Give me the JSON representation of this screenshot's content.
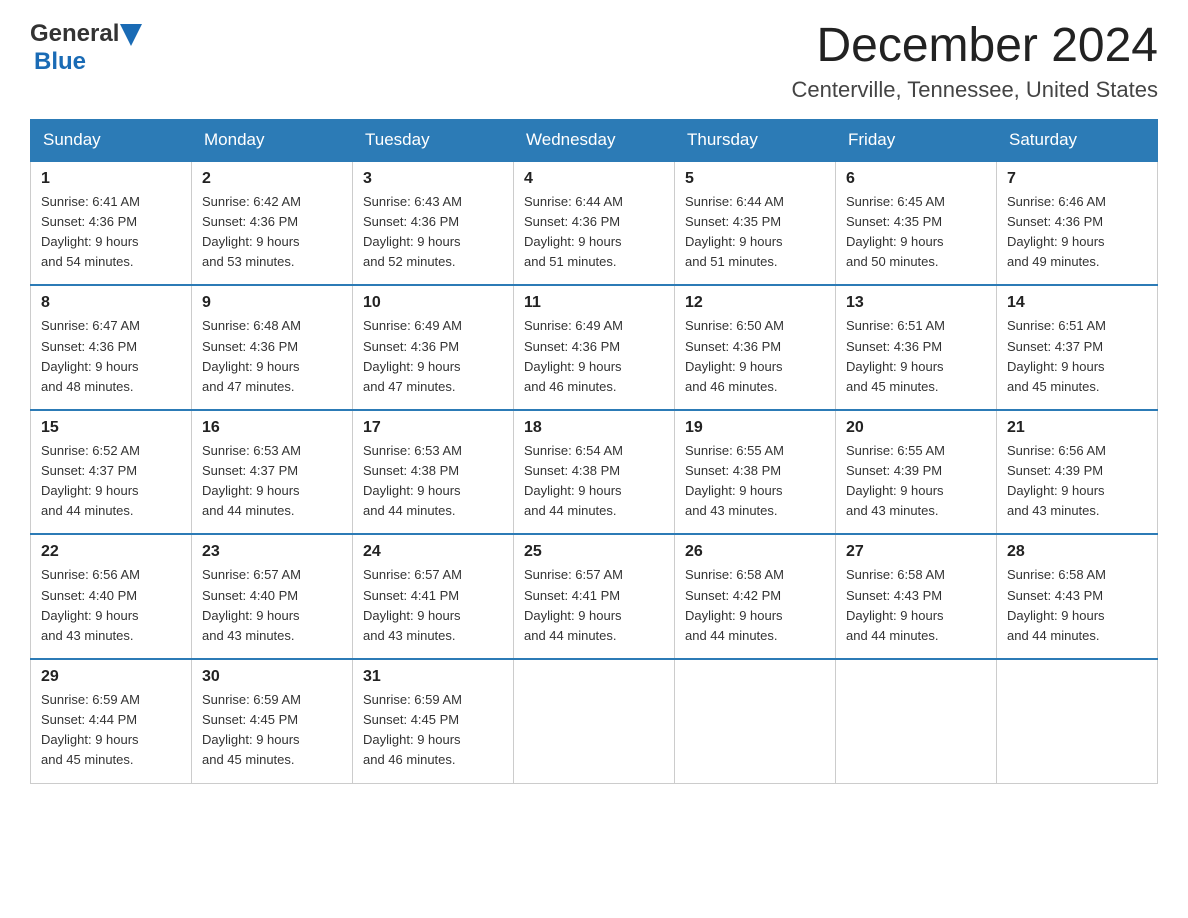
{
  "header": {
    "logo_general": "General",
    "logo_blue": "Blue",
    "month_title": "December 2024",
    "location": "Centerville, Tennessee, United States"
  },
  "days_of_week": [
    "Sunday",
    "Monday",
    "Tuesday",
    "Wednesday",
    "Thursday",
    "Friday",
    "Saturday"
  ],
  "weeks": [
    [
      {
        "day": "1",
        "sunrise": "6:41 AM",
        "sunset": "4:36 PM",
        "daylight": "9 hours and 54 minutes."
      },
      {
        "day": "2",
        "sunrise": "6:42 AM",
        "sunset": "4:36 PM",
        "daylight": "9 hours and 53 minutes."
      },
      {
        "day": "3",
        "sunrise": "6:43 AM",
        "sunset": "4:36 PM",
        "daylight": "9 hours and 52 minutes."
      },
      {
        "day": "4",
        "sunrise": "6:44 AM",
        "sunset": "4:36 PM",
        "daylight": "9 hours and 51 minutes."
      },
      {
        "day": "5",
        "sunrise": "6:44 AM",
        "sunset": "4:35 PM",
        "daylight": "9 hours and 51 minutes."
      },
      {
        "day": "6",
        "sunrise": "6:45 AM",
        "sunset": "4:35 PM",
        "daylight": "9 hours and 50 minutes."
      },
      {
        "day": "7",
        "sunrise": "6:46 AM",
        "sunset": "4:36 PM",
        "daylight": "9 hours and 49 minutes."
      }
    ],
    [
      {
        "day": "8",
        "sunrise": "6:47 AM",
        "sunset": "4:36 PM",
        "daylight": "9 hours and 48 minutes."
      },
      {
        "day": "9",
        "sunrise": "6:48 AM",
        "sunset": "4:36 PM",
        "daylight": "9 hours and 47 minutes."
      },
      {
        "day": "10",
        "sunrise": "6:49 AM",
        "sunset": "4:36 PM",
        "daylight": "9 hours and 47 minutes."
      },
      {
        "day": "11",
        "sunrise": "6:49 AM",
        "sunset": "4:36 PM",
        "daylight": "9 hours and 46 minutes."
      },
      {
        "day": "12",
        "sunrise": "6:50 AM",
        "sunset": "4:36 PM",
        "daylight": "9 hours and 46 minutes."
      },
      {
        "day": "13",
        "sunrise": "6:51 AM",
        "sunset": "4:36 PM",
        "daylight": "9 hours and 45 minutes."
      },
      {
        "day": "14",
        "sunrise": "6:51 AM",
        "sunset": "4:37 PM",
        "daylight": "9 hours and 45 minutes."
      }
    ],
    [
      {
        "day": "15",
        "sunrise": "6:52 AM",
        "sunset": "4:37 PM",
        "daylight": "9 hours and 44 minutes."
      },
      {
        "day": "16",
        "sunrise": "6:53 AM",
        "sunset": "4:37 PM",
        "daylight": "9 hours and 44 minutes."
      },
      {
        "day": "17",
        "sunrise": "6:53 AM",
        "sunset": "4:38 PM",
        "daylight": "9 hours and 44 minutes."
      },
      {
        "day": "18",
        "sunrise": "6:54 AM",
        "sunset": "4:38 PM",
        "daylight": "9 hours and 44 minutes."
      },
      {
        "day": "19",
        "sunrise": "6:55 AM",
        "sunset": "4:38 PM",
        "daylight": "9 hours and 43 minutes."
      },
      {
        "day": "20",
        "sunrise": "6:55 AM",
        "sunset": "4:39 PM",
        "daylight": "9 hours and 43 minutes."
      },
      {
        "day": "21",
        "sunrise": "6:56 AM",
        "sunset": "4:39 PM",
        "daylight": "9 hours and 43 minutes."
      }
    ],
    [
      {
        "day": "22",
        "sunrise": "6:56 AM",
        "sunset": "4:40 PM",
        "daylight": "9 hours and 43 minutes."
      },
      {
        "day": "23",
        "sunrise": "6:57 AM",
        "sunset": "4:40 PM",
        "daylight": "9 hours and 43 minutes."
      },
      {
        "day": "24",
        "sunrise": "6:57 AM",
        "sunset": "4:41 PM",
        "daylight": "9 hours and 43 minutes."
      },
      {
        "day": "25",
        "sunrise": "6:57 AM",
        "sunset": "4:41 PM",
        "daylight": "9 hours and 44 minutes."
      },
      {
        "day": "26",
        "sunrise": "6:58 AM",
        "sunset": "4:42 PM",
        "daylight": "9 hours and 44 minutes."
      },
      {
        "day": "27",
        "sunrise": "6:58 AM",
        "sunset": "4:43 PM",
        "daylight": "9 hours and 44 minutes."
      },
      {
        "day": "28",
        "sunrise": "6:58 AM",
        "sunset": "4:43 PM",
        "daylight": "9 hours and 44 minutes."
      }
    ],
    [
      {
        "day": "29",
        "sunrise": "6:59 AM",
        "sunset": "4:44 PM",
        "daylight": "9 hours and 45 minutes."
      },
      {
        "day": "30",
        "sunrise": "6:59 AM",
        "sunset": "4:45 PM",
        "daylight": "9 hours and 45 minutes."
      },
      {
        "day": "31",
        "sunrise": "6:59 AM",
        "sunset": "4:45 PM",
        "daylight": "9 hours and 46 minutes."
      },
      null,
      null,
      null,
      null
    ]
  ],
  "labels": {
    "sunrise": "Sunrise:",
    "sunset": "Sunset:",
    "daylight": "Daylight:"
  }
}
